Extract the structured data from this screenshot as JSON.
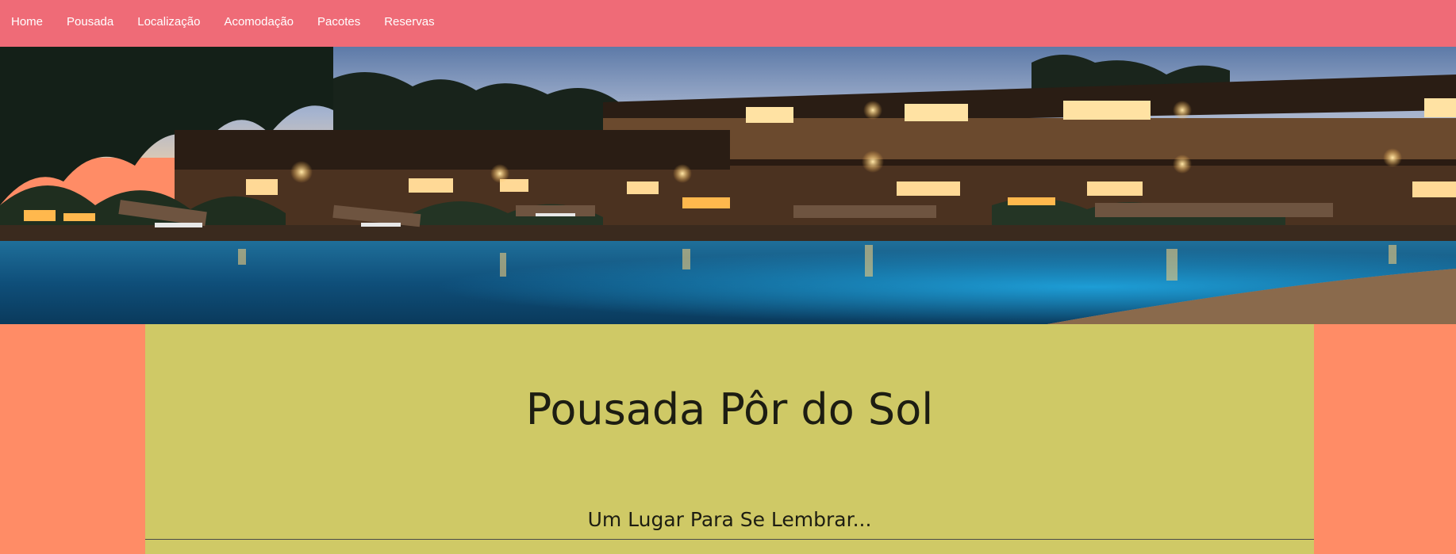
{
  "nav": {
    "items": [
      {
        "label": "Home"
      },
      {
        "label": "Pousada"
      },
      {
        "label": "Localização"
      },
      {
        "label": "Acomodação"
      },
      {
        "label": "Pacotes"
      },
      {
        "label": "Reservas"
      }
    ]
  },
  "hero": {
    "image_name": "hotel-pool-night-photo"
  },
  "main": {
    "title": "Pousada Pôr do Sol",
    "subtitle": "Um Lugar Para Se Lembrar..."
  },
  "colors": {
    "navbar": "#ef6b77",
    "page_background": "#ff8c66",
    "content_background": "#cfc966",
    "text": "#1d1d12"
  }
}
